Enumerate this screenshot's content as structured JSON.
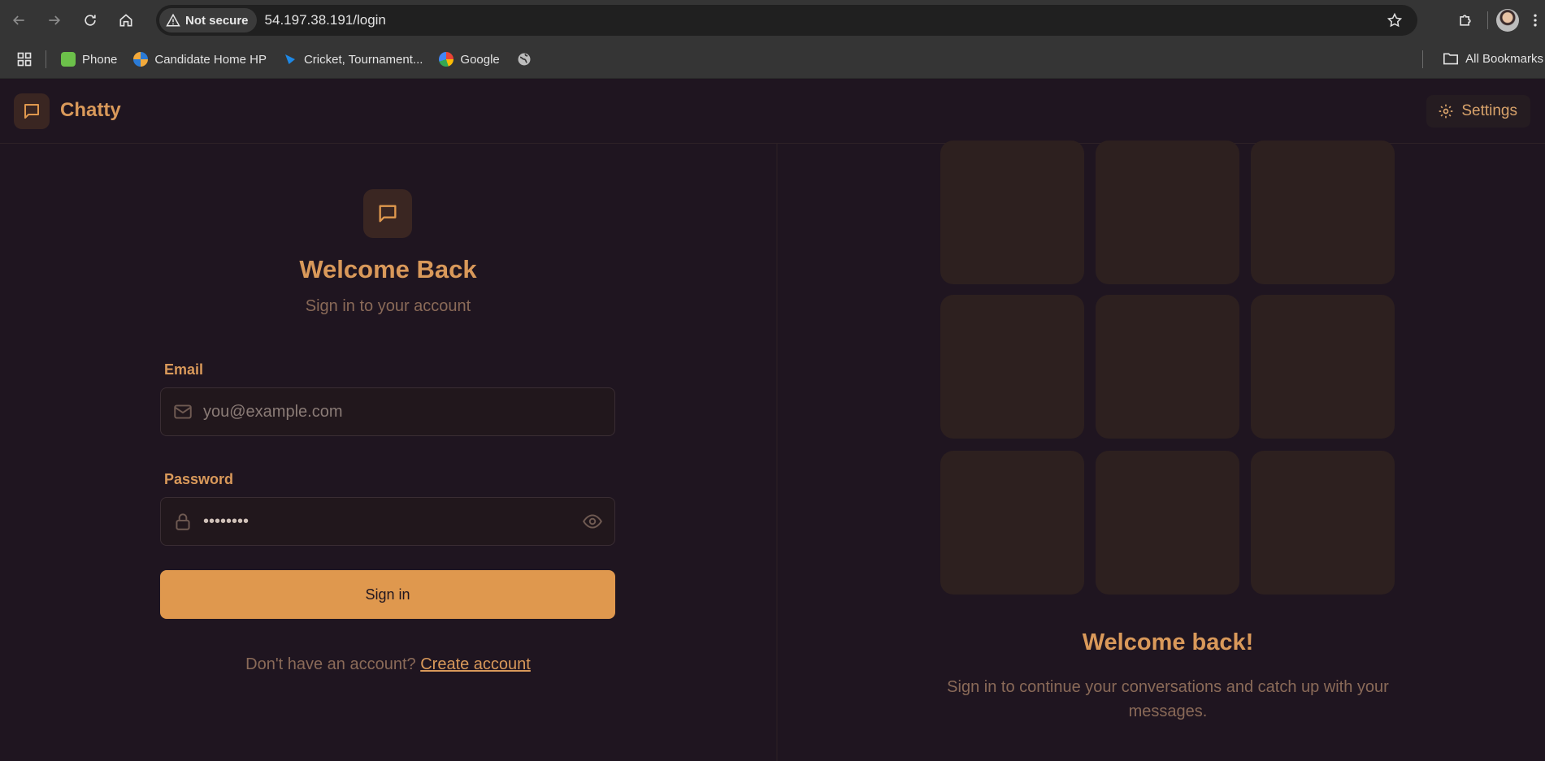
{
  "browser": {
    "security_label": "Not secure",
    "url": "54.197.38.191/login",
    "bookmarks": [
      {
        "label": "Phone",
        "color": "#6cc04a"
      },
      {
        "label": "Candidate Home HP",
        "color": "#2b7bd6"
      },
      {
        "label": "Cricket, Tournament...",
        "color": "#1e88e5"
      },
      {
        "label": "Google",
        "color": "#ea4335"
      }
    ],
    "all_bookmarks_label": "All Bookmarks"
  },
  "app": {
    "brand": "Chatty",
    "settings_label": "Settings",
    "accent_color": "#df984e"
  },
  "login": {
    "title": "Welcome Back",
    "subtitle": "Sign in to your account",
    "email_label": "Email",
    "email_placeholder": "you@example.com",
    "password_label": "Password",
    "password_value": "••••••••",
    "signin_label": "Sign in",
    "signup_prompt": "Don't have an account?",
    "signup_link": "Create account"
  },
  "promo": {
    "title": "Welcome back!",
    "text": "Sign in to continue your conversations and catch up with your messages."
  }
}
